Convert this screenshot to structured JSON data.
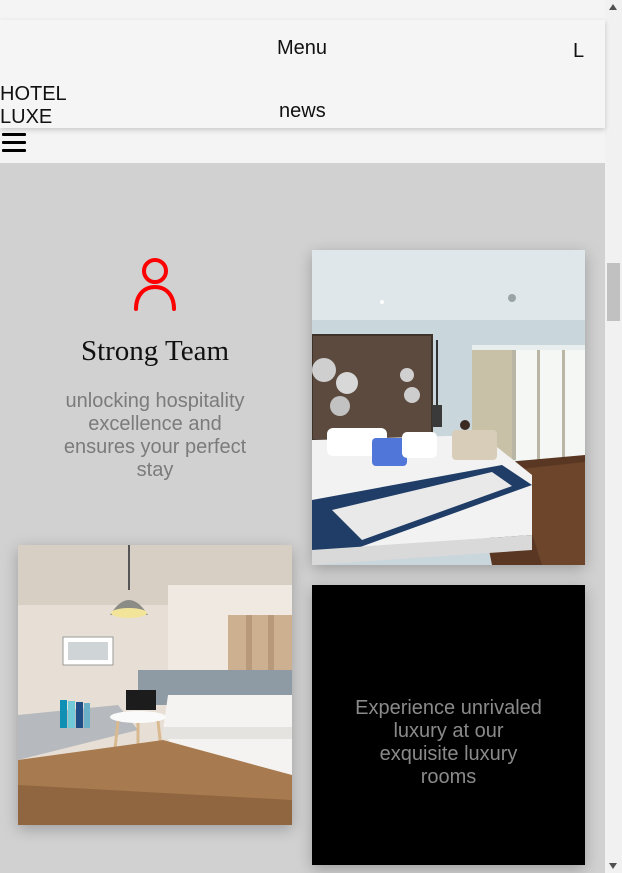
{
  "header": {
    "menu_label": "Menu",
    "news_label": "news",
    "right_label": "L",
    "brand_line1": "HOTEL",
    "brand_line2": "LUXE"
  },
  "feature": {
    "icon": "user-icon",
    "title": "Strong Team",
    "text": "unlocking hospitality excellence and ensures your perfect stay"
  },
  "tiles": {
    "room1_image": "hotel-bedroom-photo",
    "room2_image": "modern-room-photo",
    "dark_text": "Experience unrivaled luxury at our exquisite luxury rooms"
  },
  "colors": {
    "accent": "#ff0000",
    "content_bg": "#d1d1d1",
    "header_bg": "#f5f5f5",
    "dark_tile": "#000000"
  }
}
